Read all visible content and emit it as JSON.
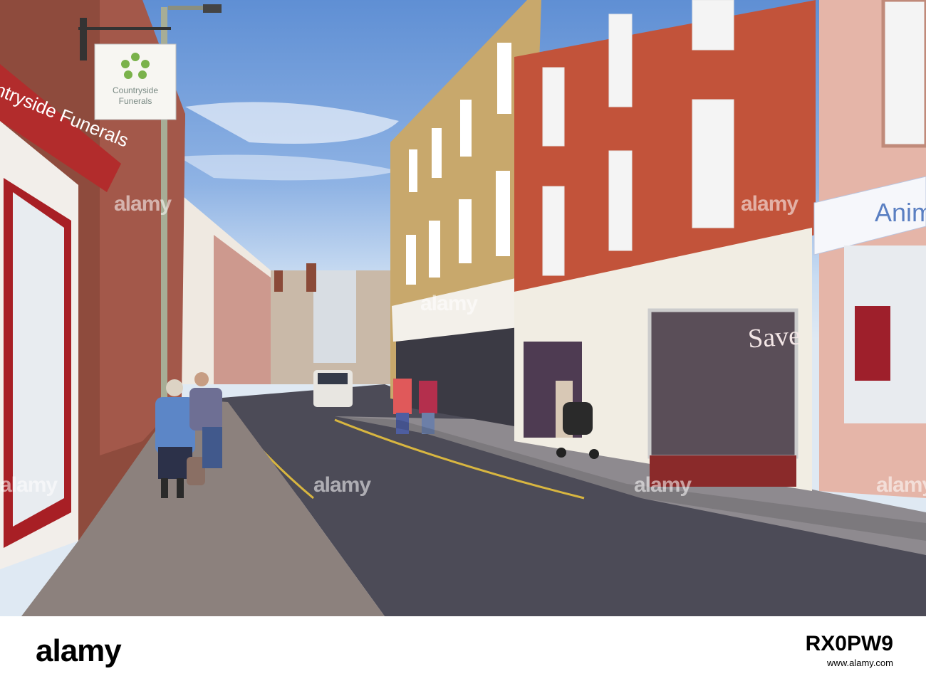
{
  "photo": {
    "description_icon": "street-scene",
    "signs": {
      "hanging_sign_line1": "Countryside",
      "hanging_sign_line2": "Funerals",
      "shopfront_name": "ntryside Funerals",
      "window_word": "Save",
      "pet_shop_partial": "Anim"
    },
    "watermarks": [
      "alamy",
      "alamy",
      "alamy",
      "alamy",
      "alamy",
      "alamy",
      "alamy"
    ]
  },
  "footer": {
    "logo": "alamy",
    "image_code": "RX0PW9",
    "url": "www.alamy.com"
  },
  "colors": {
    "sky": "#8fb3e4",
    "brick": "#b8533b",
    "road": "#4a4a55",
    "pavement": "#8f8682"
  }
}
